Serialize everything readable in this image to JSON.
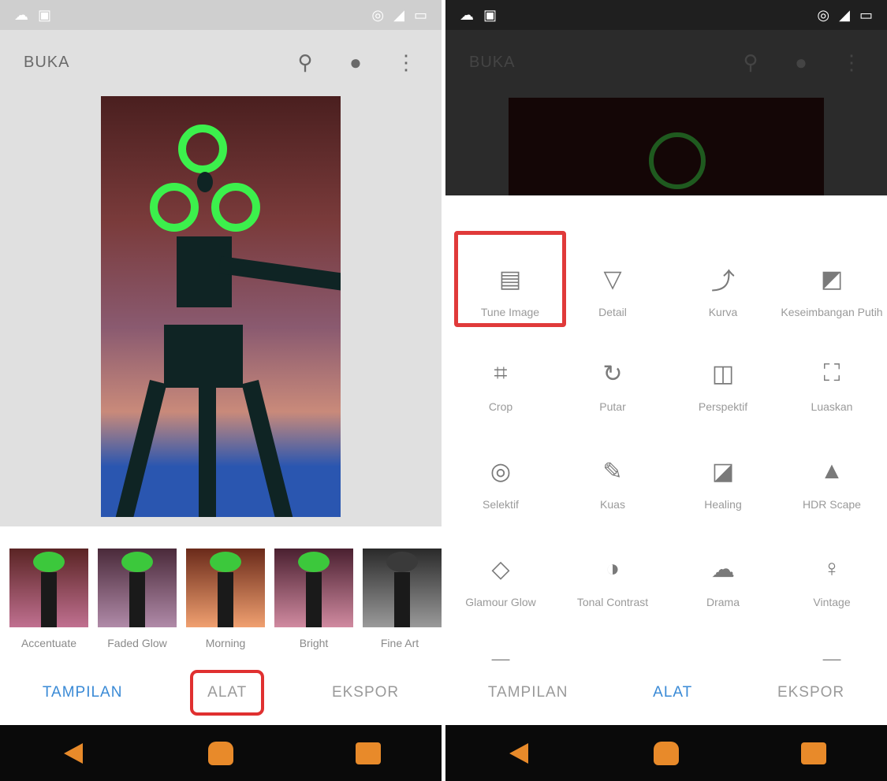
{
  "left_screen": {
    "app_title": "BUKA",
    "icons": [
      "hanger-icon",
      "info-icon",
      "overflow-menu-icon"
    ],
    "filters": [
      {
        "label": "Accentuate"
      },
      {
        "label": "Faded Glow"
      },
      {
        "label": "Morning"
      },
      {
        "label": "Bright"
      },
      {
        "label": "Fine Art"
      }
    ],
    "tabs": [
      {
        "label": "TAMPILAN",
        "color": "#3a8ad6"
      },
      {
        "label": "ALAT",
        "color": "#9a9a9a"
      },
      {
        "label": "EKSPOR",
        "color": "#9a9a9a"
      }
    ]
  },
  "right_screen": {
    "app_title": "BUKA",
    "tools": [
      {
        "label": "Tune Image",
        "icon": "tune-icon"
      },
      {
        "label": "Detail",
        "icon": "detail-icon"
      },
      {
        "label": "Kurva",
        "icon": "curves-icon"
      },
      {
        "label": "Keseimbangan Putih",
        "icon": "white-balance-icon"
      },
      {
        "label": "Crop",
        "icon": "crop-icon"
      },
      {
        "label": "Putar",
        "icon": "rotate-icon"
      },
      {
        "label": "Perspektif",
        "icon": "perspective-icon"
      },
      {
        "label": "Luaskan",
        "icon": "expand-icon"
      },
      {
        "label": "Selektif",
        "icon": "selective-icon"
      },
      {
        "label": "Kuas",
        "icon": "brush-icon"
      },
      {
        "label": "Healing",
        "icon": "healing-icon"
      },
      {
        "label": "HDR Scape",
        "icon": "hdr-icon"
      },
      {
        "label": "Glamour Glow",
        "icon": "glamour-glow-icon"
      },
      {
        "label": "Tonal Contrast",
        "icon": "tonal-contrast-icon"
      },
      {
        "label": "Drama",
        "icon": "drama-icon"
      },
      {
        "label": "Vintage",
        "icon": "vintage-icon"
      },
      {
        "label": "",
        "icon": "grainy-film-icon"
      },
      {
        "label": "",
        "icon": "retrolux-icon"
      },
      {
        "label": "",
        "icon": "grunge-icon"
      },
      {
        "label": "",
        "icon": "black-white-icon"
      }
    ],
    "tabs": [
      {
        "label": "TAMPILAN",
        "color": "#9a9a9a"
      },
      {
        "label": "ALAT",
        "color": "#3a8ad6"
      },
      {
        "label": "EKSPOR",
        "color": "#9a9a9a"
      }
    ]
  },
  "colors": {
    "highlight": "#e03030",
    "accent_blue": "#3a8ad6",
    "nav_orange": "#e88a2a"
  }
}
